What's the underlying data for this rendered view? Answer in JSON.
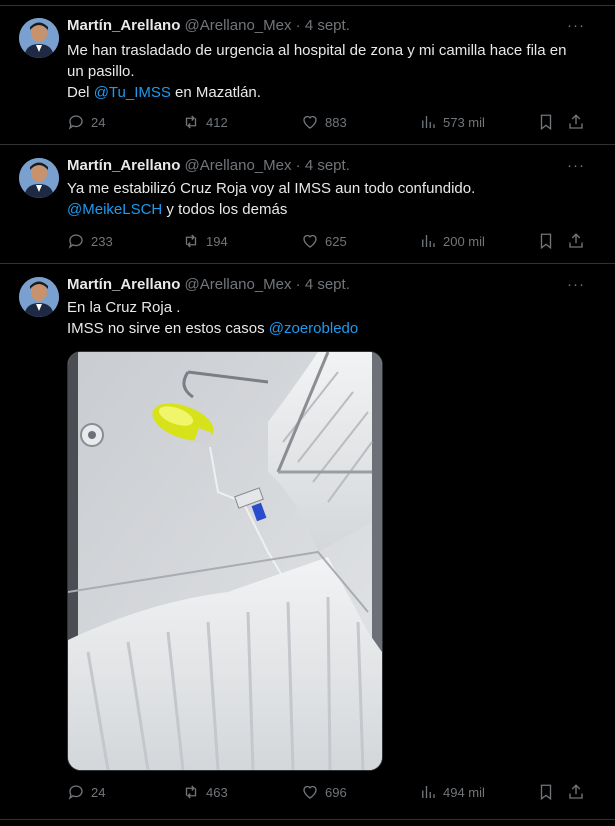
{
  "tweets": [
    {
      "author": "Martín_Arellano",
      "handle": "@Arellano_Mex",
      "separator": "·",
      "date": "4 sept.",
      "text_line1": "Me han trasladado de urgencia al hospital de zona y mi camilla hace fila en",
      "text_line2": "un pasillo.",
      "text_line3_pre": "Del ",
      "text_line3_mention": "@Tu_IMSS",
      "text_line3_post": " en Mazatlán.",
      "replies": "24",
      "reposts": "412",
      "likes": "883",
      "views": "573 mil"
    },
    {
      "author": "Martín_Arellano",
      "handle": "@Arellano_Mex",
      "separator": "·",
      "date": "4 sept.",
      "text_line1": "Ya me estabilizó Cruz Roja voy al IMSS aun todo confundido.",
      "text_line2_mention": "@MeikeLSCH",
      "text_line2_post": " y todos los demás",
      "replies": "233",
      "reposts": "194",
      "likes": "625",
      "views": "200 mil"
    },
    {
      "author": "Martín_Arellano",
      "handle": "@Arellano_Mex",
      "separator": "·",
      "date": "4 sept.",
      "text_line1": "En la Cruz Roja .",
      "text_line2_pre": "IMSS no sirve en estos casos ",
      "text_line2_mention": "@zoerobledo",
      "replies": "24",
      "reposts": "463",
      "likes": "696",
      "views": "494 mil"
    }
  ],
  "more_glyph": "···",
  "colors": {
    "background": "#000000",
    "text": "#e7e9ea",
    "muted": "#71767b",
    "link": "#1d9bf0",
    "divider": "#2f3336"
  }
}
